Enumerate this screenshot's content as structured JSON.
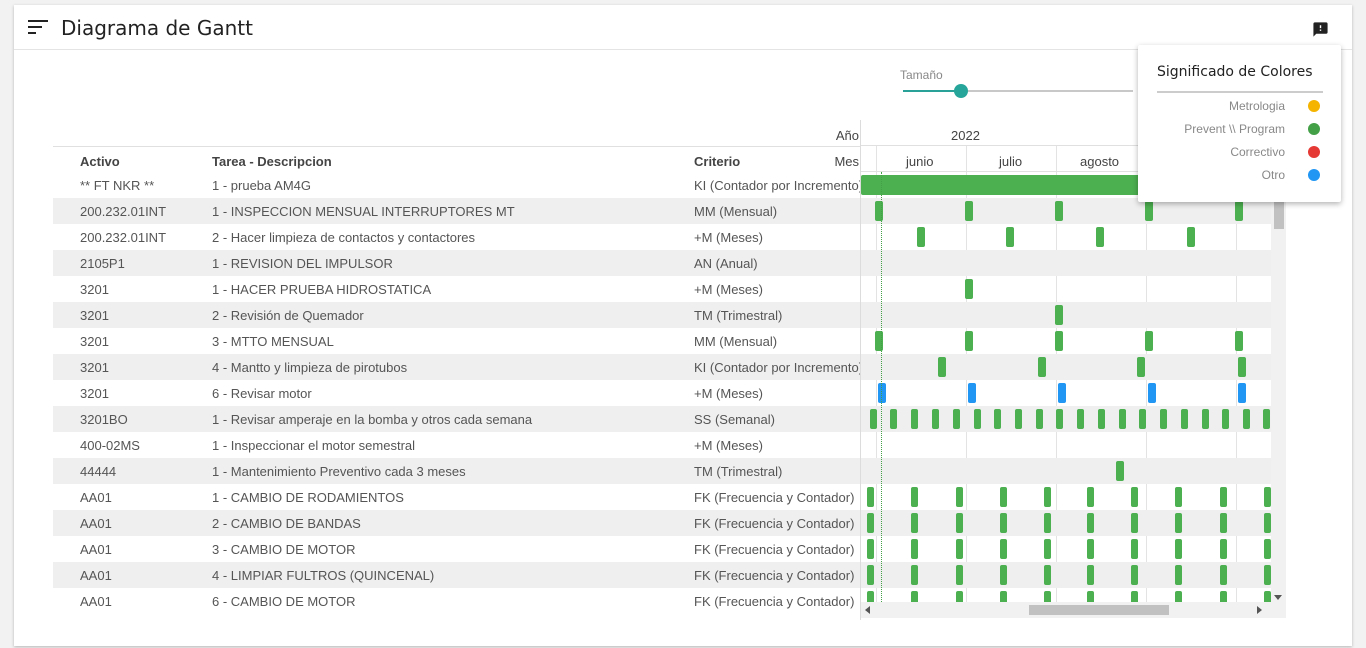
{
  "header": {
    "title": "Diagrama de Gantt",
    "menu_icon": "menu-icon",
    "feedback_icon": "feedback-icon"
  },
  "size_control": {
    "label": "Tamaño",
    "value_fraction": 0.25
  },
  "table": {
    "labels": {
      "anio": "Año",
      "mes": "Mes"
    },
    "columns": [
      "Activo",
      "Tarea - Descripcion",
      "Criterio"
    ],
    "rows": [
      [
        "** FT NKR **",
        "1 - prueba AM4G",
        "KI (Contador por Incremento)"
      ],
      [
        "200.232.01INT",
        "1 - INSPECCION MENSUAL INTERRUPTORES MT",
        "MM (Mensual)"
      ],
      [
        "200.232.01INT",
        "2 - Hacer limpieza de contactos y contactores",
        "+M (Meses)"
      ],
      [
        "2105P1",
        "1 - REVISION DEL IMPULSOR",
        "AN (Anual)"
      ],
      [
        "3201",
        "1 - HACER PRUEBA HIDROSTATICA",
        "+M (Meses)"
      ],
      [
        "3201",
        "2 - Revisión de Quemador",
        "TM (Trimestral)"
      ],
      [
        "3201",
        "3 - MTTO MENSUAL",
        "MM (Mensual)"
      ],
      [
        "3201",
        "4 - Mantto y limpieza de pirotubos",
        "KI (Contador por Incremento)"
      ],
      [
        "3201",
        "6 - Revisar motor",
        "+M (Meses)"
      ],
      [
        "3201BO",
        "1 - Revisar amperaje en la bomba y otros cada semana",
        "SS (Semanal)"
      ],
      [
        "400-02MS",
        "1 - Inspeccionar el motor semestral",
        "+M (Meses)"
      ],
      [
        "44444",
        "1 - Mantenimiento Preventivo cada 3 meses",
        "TM (Trimestral)"
      ],
      [
        "AA01",
        "1 - CAMBIO DE RODAMIENTOS",
        "FK (Frecuencia y Contador)"
      ],
      [
        "AA01",
        "2 - CAMBIO DE BANDAS",
        "FK (Frecuencia y Contador)"
      ],
      [
        "AA01",
        "3 - CAMBIO DE MOTOR",
        "FK (Frecuencia y Contador)"
      ],
      [
        "AA01",
        "4 - LIMPIAR FULTROS (QUINCENAL)",
        "FK (Frecuencia y Contador)"
      ],
      [
        "AA01",
        "6 - CAMBIO DE MOTOR",
        "FK (Frecuencia y Contador)"
      ]
    ]
  },
  "gantt": {
    "year": "2022",
    "months": [
      "junio",
      "julio",
      "agosto"
    ],
    "bar_colors": {
      "green": "#4caf50",
      "blue": "#2196f3"
    }
  },
  "legend": {
    "title": "Significado de Colores",
    "items": [
      {
        "label": "Metrologia",
        "color": "#f4b400"
      },
      {
        "label": "Prevent \\\\ Program",
        "color": "#43a047"
      },
      {
        "label": "Correctivo",
        "color": "#e53935"
      },
      {
        "label": "Otro",
        "color": "#2196f3"
      }
    ]
  }
}
